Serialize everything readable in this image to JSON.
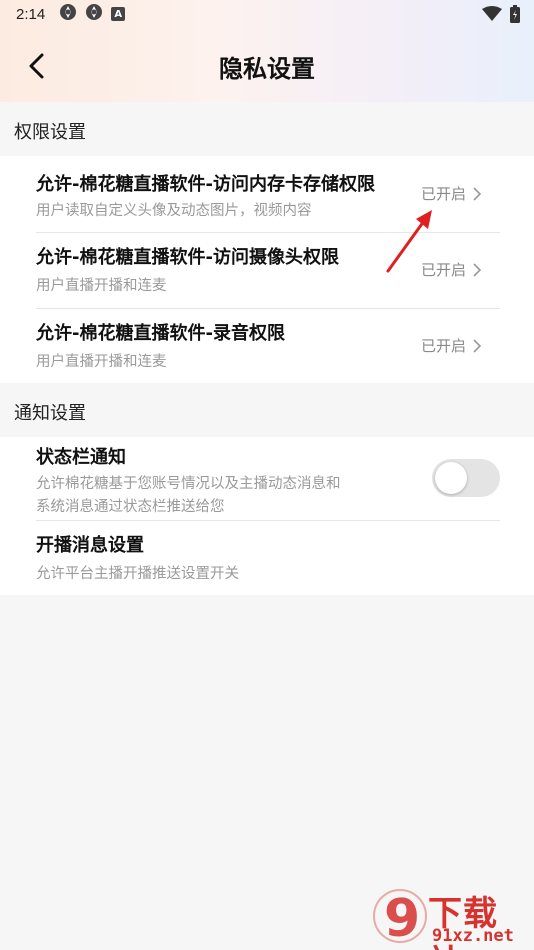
{
  "status_bar": {
    "time": "2:14",
    "badge_icon": "A",
    "left_icons": [
      "app-notification-icon",
      "app-notification-icon",
      "a-badge-icon"
    ],
    "right_icons": [
      "wifi-icon",
      "battery-icon"
    ]
  },
  "header": {
    "title": "隐私设置",
    "back_icon": "chevron-left-icon"
  },
  "sections": [
    {
      "label": "权限设置",
      "rows": [
        {
          "title": "允许-棉花糖直播软件-访问内存卡存储权限",
          "desc": "用户读取自定义头像及动态图片，视频内容",
          "status": "已开启"
        },
        {
          "title": "允许-棉花糖直播软件-访问摄像头权限",
          "desc": "用户直播开播和连麦",
          "status": "已开启"
        },
        {
          "title": "允许-棉花糖直播软件-录音权限",
          "desc": "用户直播开播和连麦",
          "status": "已开启"
        }
      ]
    },
    {
      "label": "通知设置",
      "rows": [
        {
          "title": "状态栏通知",
          "desc_lines": [
            "允许棉花糖基于您账号情况以及主播动态消息和",
            "系统消息通过状态栏推送给您"
          ],
          "toggle_on": false
        },
        {
          "title": "开播消息设置",
          "desc": "允许平台主播开播推送设置开关"
        }
      ]
    }
  ],
  "watermark": {
    "line1": "下载站",
    "line2": "91xz.net",
    "logo_glyph": "9"
  },
  "colors": {
    "accent_red": "#d6332f",
    "annotation_arrow": "#e02020",
    "toggle_off": "#e4e4e4",
    "secondary_text": "#9a9a9a"
  }
}
